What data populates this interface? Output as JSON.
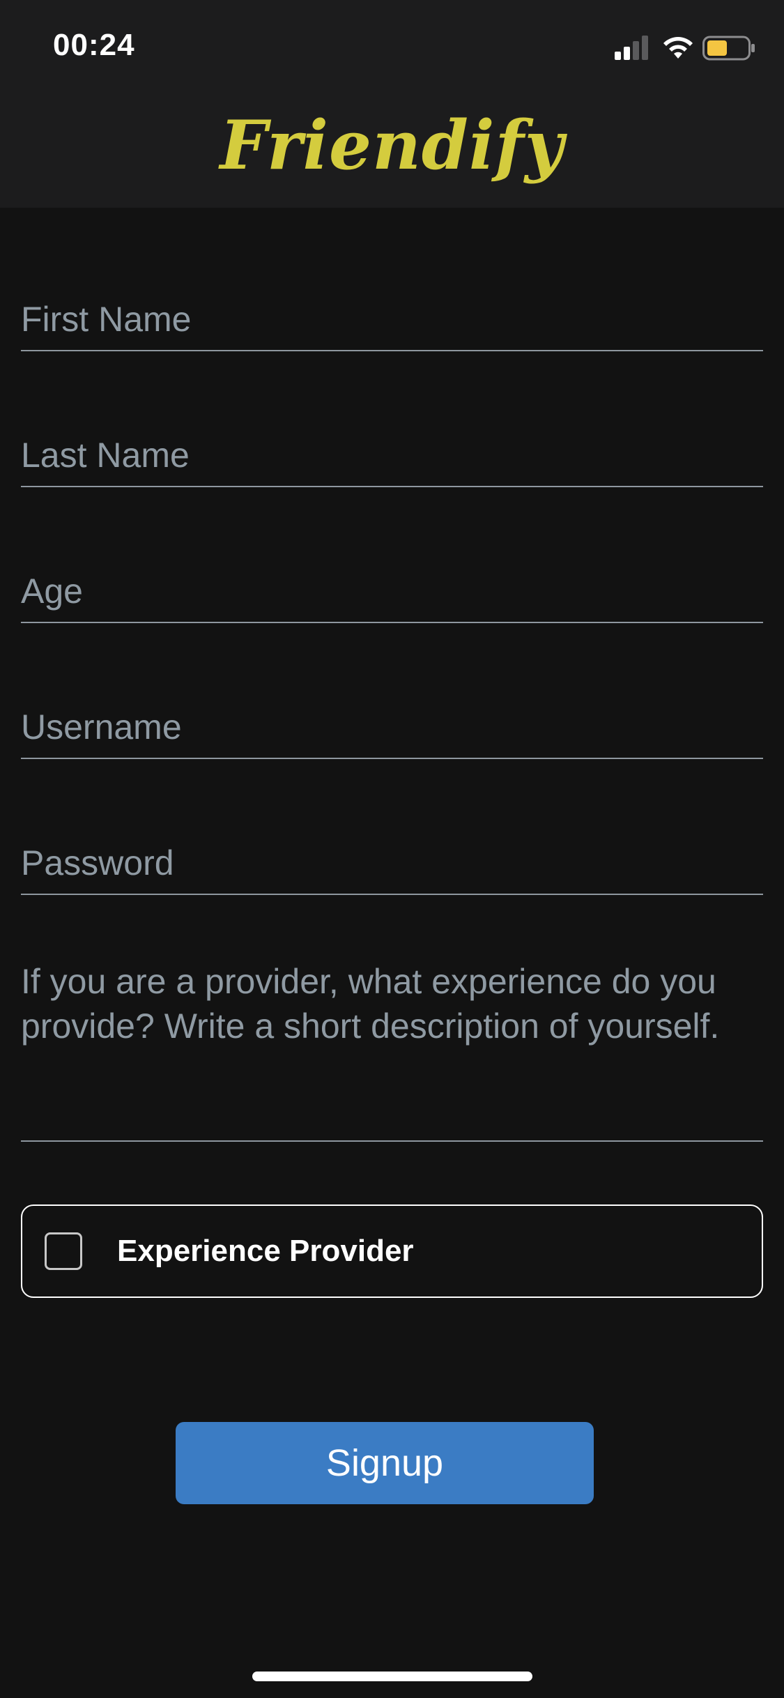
{
  "status_bar": {
    "time": "00:24",
    "signal_icon": "cellular-signal-icon",
    "wifi_icon": "wifi-icon",
    "battery_icon": "battery-icon",
    "battery_color": "#f4c542",
    "battery_level": 0.5
  },
  "header": {
    "logo_text": "Friendify",
    "logo_color": "#d4cc3e"
  },
  "form": {
    "first_name": {
      "placeholder": "First Name",
      "value": ""
    },
    "last_name": {
      "placeholder": "Last Name",
      "value": ""
    },
    "age": {
      "placeholder": "Age",
      "value": ""
    },
    "username": {
      "placeholder": "Username",
      "value": ""
    },
    "password": {
      "placeholder": "Password",
      "value": ""
    },
    "description": {
      "placeholder": "If you are a provider, what experience do you provide? Write a short description of yourself.",
      "value": ""
    },
    "provider_checkbox": {
      "label": "Experience Provider",
      "checked": false
    },
    "signup_label": "Signup",
    "accent_color": "#3b7cc4"
  }
}
